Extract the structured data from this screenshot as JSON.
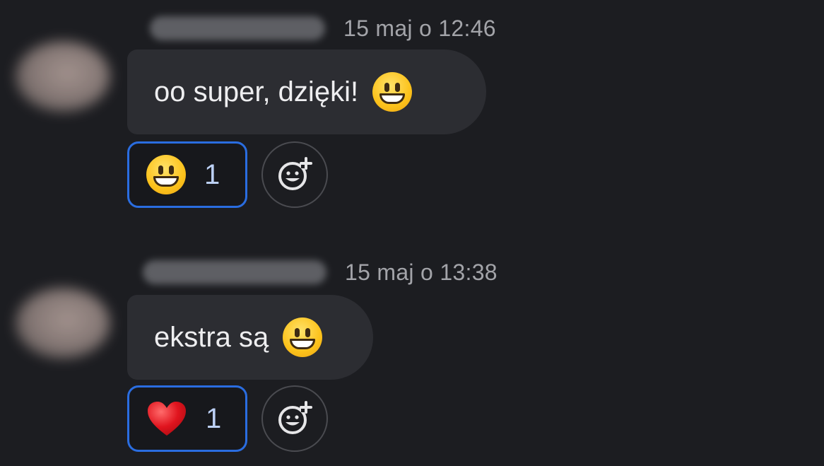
{
  "messages": [
    {
      "timestamp": "15 maj o 12:46",
      "text": "oo super, dzięki!",
      "text_emoji": "grinning-face",
      "reaction": {
        "emoji": "grinning-face",
        "count": "1",
        "selected": true
      }
    },
    {
      "timestamp": "15 maj o 13:38",
      "text": "ekstra są",
      "text_emoji": "grinning-face",
      "reaction": {
        "emoji": "red-heart",
        "count": "1",
        "selected": true
      }
    }
  ],
  "add_reaction_icon": "add-reaction-icon",
  "colors": {
    "background": "#1c1d21",
    "bubble": "#2c2d32",
    "reaction_border": "#2a6de0",
    "timestamp": "#a3a4a9"
  }
}
